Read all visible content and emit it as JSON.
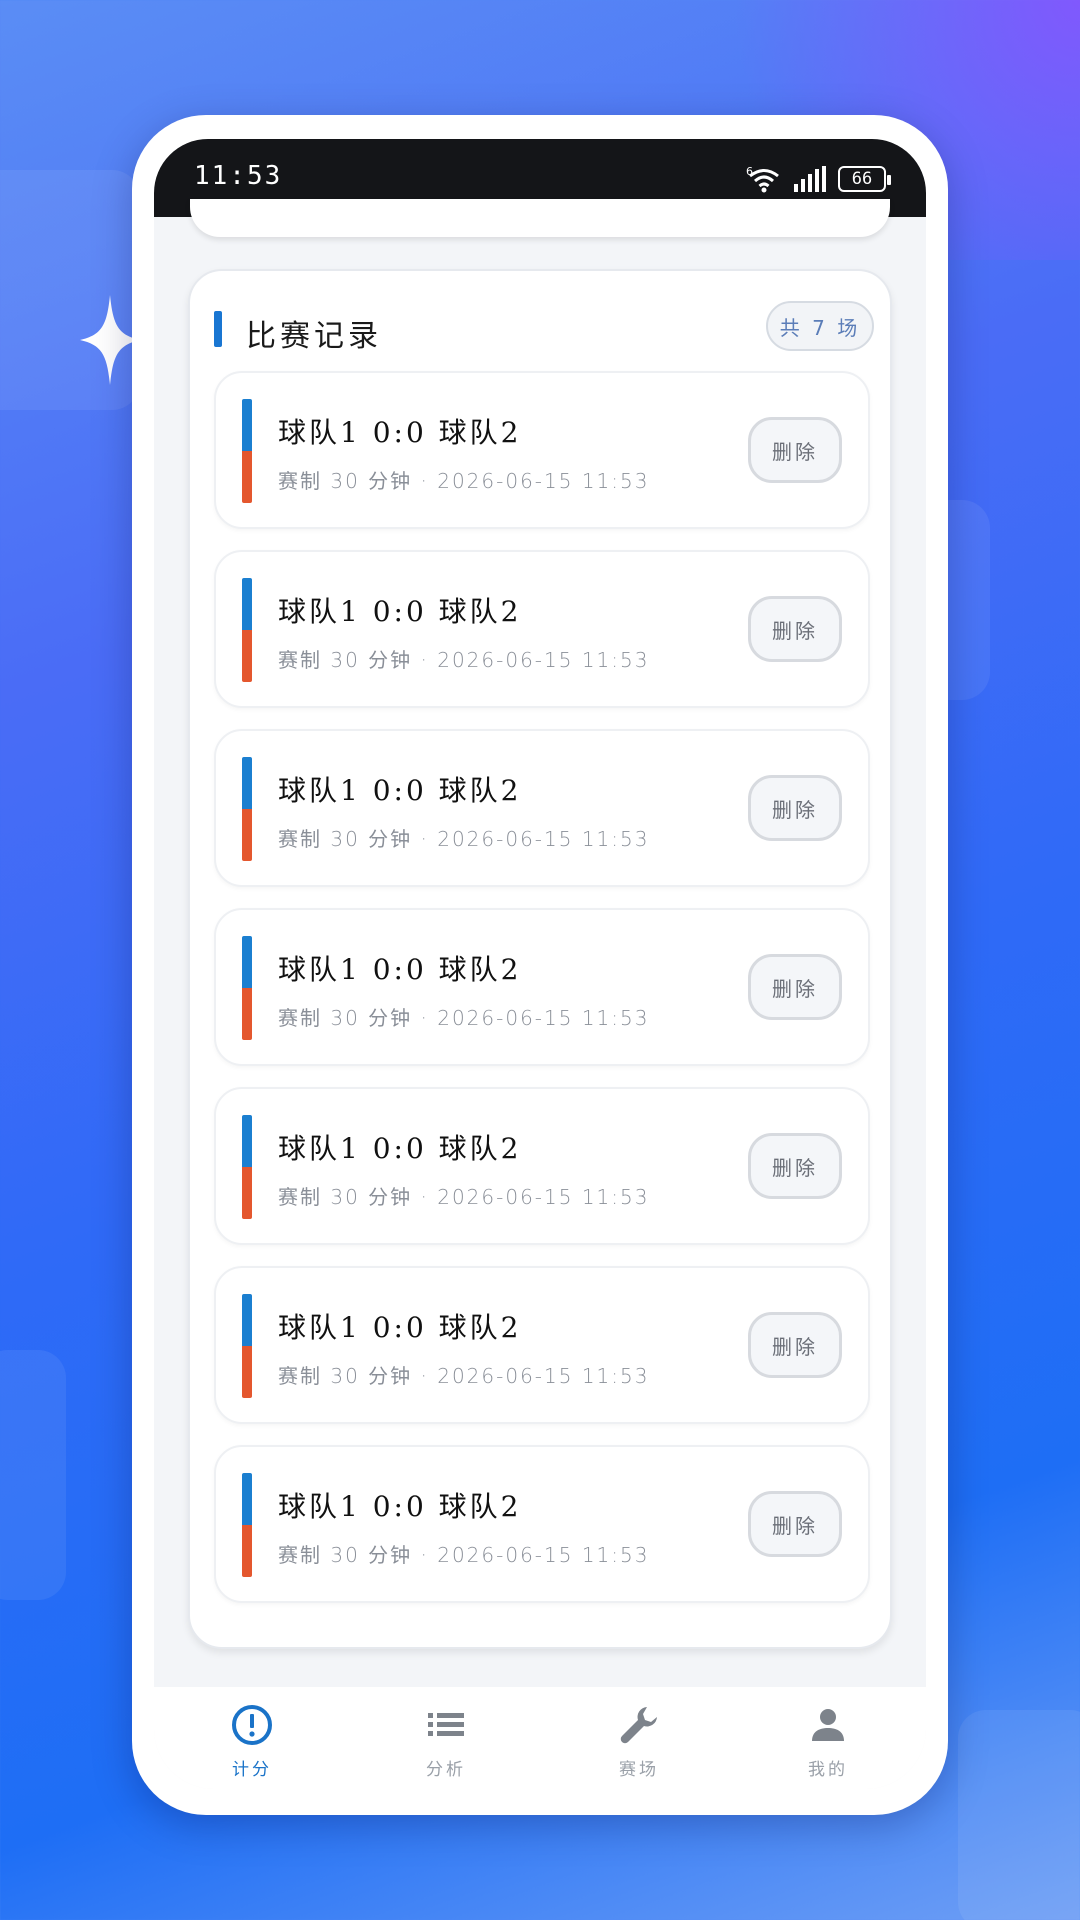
{
  "status_bar": {
    "time": "11:53",
    "network_tag": "6",
    "battery": "66"
  },
  "records": {
    "title": "比赛记录",
    "count": "共 7 场",
    "items": [
      {
        "score": "球队1 0:0 球队2",
        "meta": "赛制 30 分钟 · 2026-06-15 11:53",
        "delete_label": "删除"
      },
      {
        "score": "球队1 0:0 球队2",
        "meta": "赛制 30 分钟 · 2026-06-15 11:53",
        "delete_label": "删除"
      },
      {
        "score": "球队1 0:0 球队2",
        "meta": "赛制 30 分钟 · 2026-06-15 11:53",
        "delete_label": "删除"
      },
      {
        "score": "球队1 0:0 球队2",
        "meta": "赛制 30 分钟 · 2026-06-15 11:53",
        "delete_label": "删除"
      },
      {
        "score": "球队1 0:0 球队2",
        "meta": "赛制 30 分钟 · 2026-06-15 11:53",
        "delete_label": "删除"
      },
      {
        "score": "球队1 0:0 球队2",
        "meta": "赛制 30 分钟 · 2026-06-15 11:53",
        "delete_label": "删除"
      },
      {
        "score": "球队1 0:0 球队2",
        "meta": "赛制 30 分钟 · 2026-06-15 11:53",
        "delete_label": "删除"
      }
    ]
  },
  "nav": {
    "items": [
      {
        "label": "计分",
        "icon": "alert-circle-icon",
        "active": true
      },
      {
        "label": "分析",
        "icon": "list-icon",
        "active": false
      },
      {
        "label": "赛场",
        "icon": "wrench-icon",
        "active": false
      },
      {
        "label": "我的",
        "icon": "person-icon",
        "active": false
      }
    ]
  },
  "colors": {
    "accent": "#1976d2",
    "team1": "#1b7fd0",
    "team2": "#e4572e"
  }
}
